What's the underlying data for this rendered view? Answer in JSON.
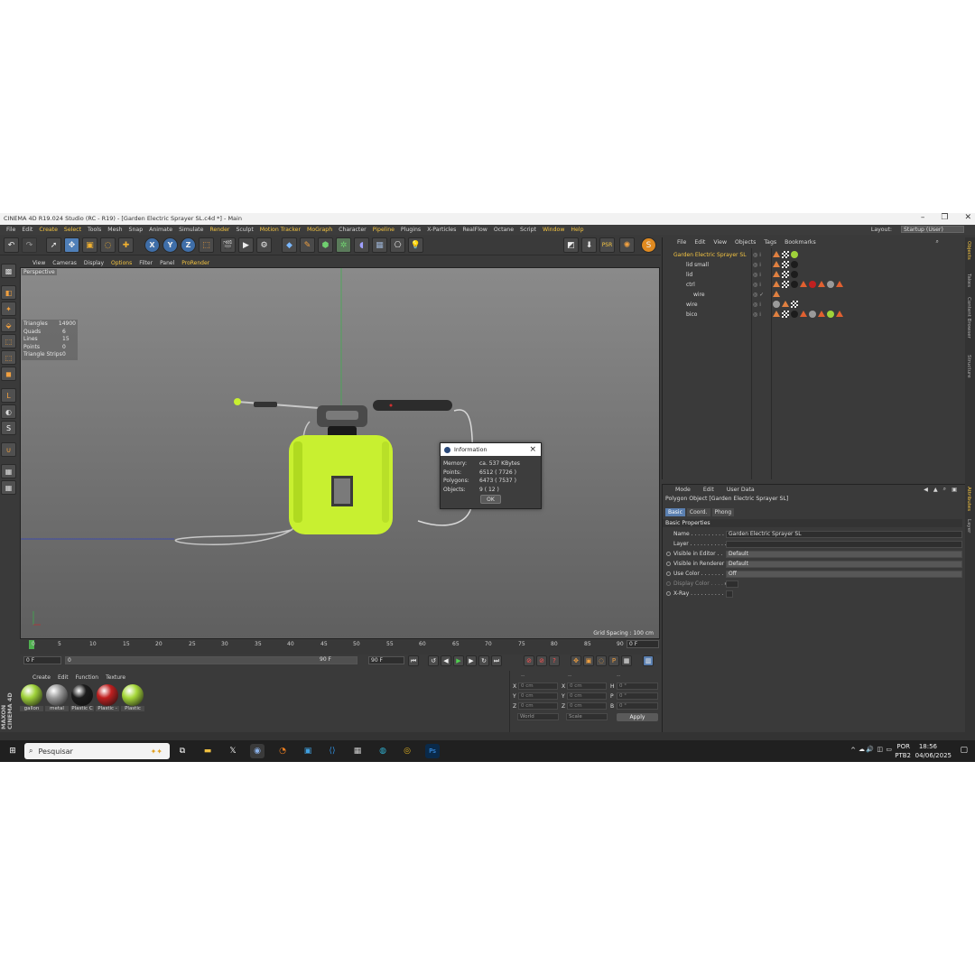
{
  "window": {
    "title": "CINEMA 4D R19.024 Studio (RC - R19) - [Garden Electric Sprayer SL.c4d *] - Main",
    "min": "–",
    "max": "❐",
    "close": "✕"
  },
  "menu": [
    "File",
    "Edit",
    "Create",
    "Select",
    "Tools",
    "Mesh",
    "Snap",
    "Animate",
    "Simulate",
    "Render",
    "Sculpt",
    "Motion Tracker",
    "MoGraph",
    "Character",
    "Pipeline",
    "Plugins",
    "X-Particles",
    "RealFlow",
    "Octane",
    "Script",
    "Window",
    "Help"
  ],
  "layout": {
    "label": "Layout:",
    "value": "Startup (User)"
  },
  "viewport": {
    "menu": [
      "View",
      "Cameras",
      "Display",
      "Options",
      "Filter",
      "Panel",
      "ProRender"
    ],
    "label": "Perspective",
    "grid_spacing": "Grid Spacing : 100 cm",
    "stats": [
      {
        "k": "Triangles",
        "v": "14900"
      },
      {
        "k": "Quads",
        "v": "6"
      },
      {
        "k": "Lines",
        "v": "15"
      },
      {
        "k": "Points",
        "v": "0"
      },
      {
        "k": "Triangle Strips",
        "v": "0"
      }
    ]
  },
  "dialog": {
    "title": "Information",
    "rows": [
      {
        "k": "Memory:",
        "v": "ca. 537 KBytes"
      },
      {
        "k": "Points:",
        "v": "6512 ( 7726 )"
      },
      {
        "k": "Polygons:",
        "v": "6473 ( 7537 )"
      },
      {
        "k": "Objects:",
        "v": "9 ( 12 )"
      }
    ],
    "ok": "OK"
  },
  "timeline": {
    "ticks": [
      "0",
      "5",
      "10",
      "15",
      "20",
      "25",
      "30",
      "35",
      "40",
      "45",
      "50",
      "55",
      "60",
      "65",
      "70",
      "75",
      "80",
      "85",
      "90"
    ],
    "current_frame": "0 F",
    "start": "0 F",
    "mid": "0",
    "end_field": "90 F",
    "end_field2": "90 F"
  },
  "materials": {
    "menu": [
      "Create",
      "Edit",
      "Function",
      "Texture"
    ],
    "items": [
      {
        "label": "gallon",
        "color": "#9fd23a"
      },
      {
        "label": "metal",
        "color": "#9a9a9a"
      },
      {
        "label": "Plastic C",
        "color": "#1c1c1c"
      },
      {
        "label": "Plastic -",
        "color": "#c02020"
      },
      {
        "label": "Plastic",
        "color": "#a6d83a"
      }
    ]
  },
  "brand": "MAXON CINEMA 4D",
  "coords": {
    "headers": [
      "--",
      "--",
      "--"
    ],
    "rows": [
      {
        "a": "X",
        "av": "0 cm",
        "b": "X",
        "bv": "0 cm",
        "c": "H",
        "cv": "0 °"
      },
      {
        "a": "Y",
        "av": "0 cm",
        "b": "Y",
        "bv": "0 cm",
        "c": "P",
        "cv": "0 °"
      },
      {
        "a": "Z",
        "av": "0 cm",
        "b": "Z",
        "bv": "0 cm",
        "c": "B",
        "cv": "0 °"
      }
    ],
    "world": "World",
    "scale": "Scale",
    "apply": "Apply"
  },
  "objects": {
    "menu": [
      "File",
      "Edit",
      "View",
      "Objects",
      "Tags",
      "Bookmarks"
    ],
    "items": [
      {
        "name": "Garden Electric Sprayer SL",
        "indent": 12,
        "selected": true
      },
      {
        "name": "lid small",
        "indent": 26,
        "selected": false
      },
      {
        "name": "lid",
        "indent": 26,
        "selected": false
      },
      {
        "name": "ctrl",
        "indent": 26,
        "selected": false
      },
      {
        "name": "wire",
        "indent": 34,
        "selected": false
      },
      {
        "name": "wire",
        "indent": 26,
        "selected": false
      },
      {
        "name": "bico",
        "indent": 26,
        "selected": false
      }
    ]
  },
  "attributes": {
    "menu": [
      "Mode",
      "Edit",
      "User Data"
    ],
    "title": "Polygon Object [Garden Electric Sprayer SL]",
    "tabs": [
      "Basic",
      "Coord.",
      "Phong"
    ],
    "section": "Basic Properties",
    "rows": [
      {
        "label": "Name . . . . . . . . . . .",
        "value": "Garden Electric Sprayer SL"
      },
      {
        "label": "Layer . . . . . . . . . . .",
        "value": ""
      },
      {
        "label": "Visible in Editor . .",
        "value": "Default"
      },
      {
        "label": "Visible in Renderer",
        "value": "Default"
      },
      {
        "label": "Use Color . . . . . . .",
        "value": "Off"
      },
      {
        "label": "Display Color . . . . ▸",
        "value": ""
      },
      {
        "label": "X-Ray . . . . . . . . . .",
        "value": ""
      }
    ]
  },
  "right_tabs": [
    "Objects",
    "Takes",
    "Content Browser",
    "Structure",
    "Attributes",
    "Layer"
  ],
  "taskbar": {
    "search_placeholder": "Pesquisar",
    "lang": "POR",
    "lang2": "PTB2",
    "time": "18:56",
    "date": "04/06/2025"
  },
  "colors": {
    "accent": "#f5c542",
    "selection_blue": "#5a7fb0",
    "sprayer_body": "#c8f030"
  }
}
